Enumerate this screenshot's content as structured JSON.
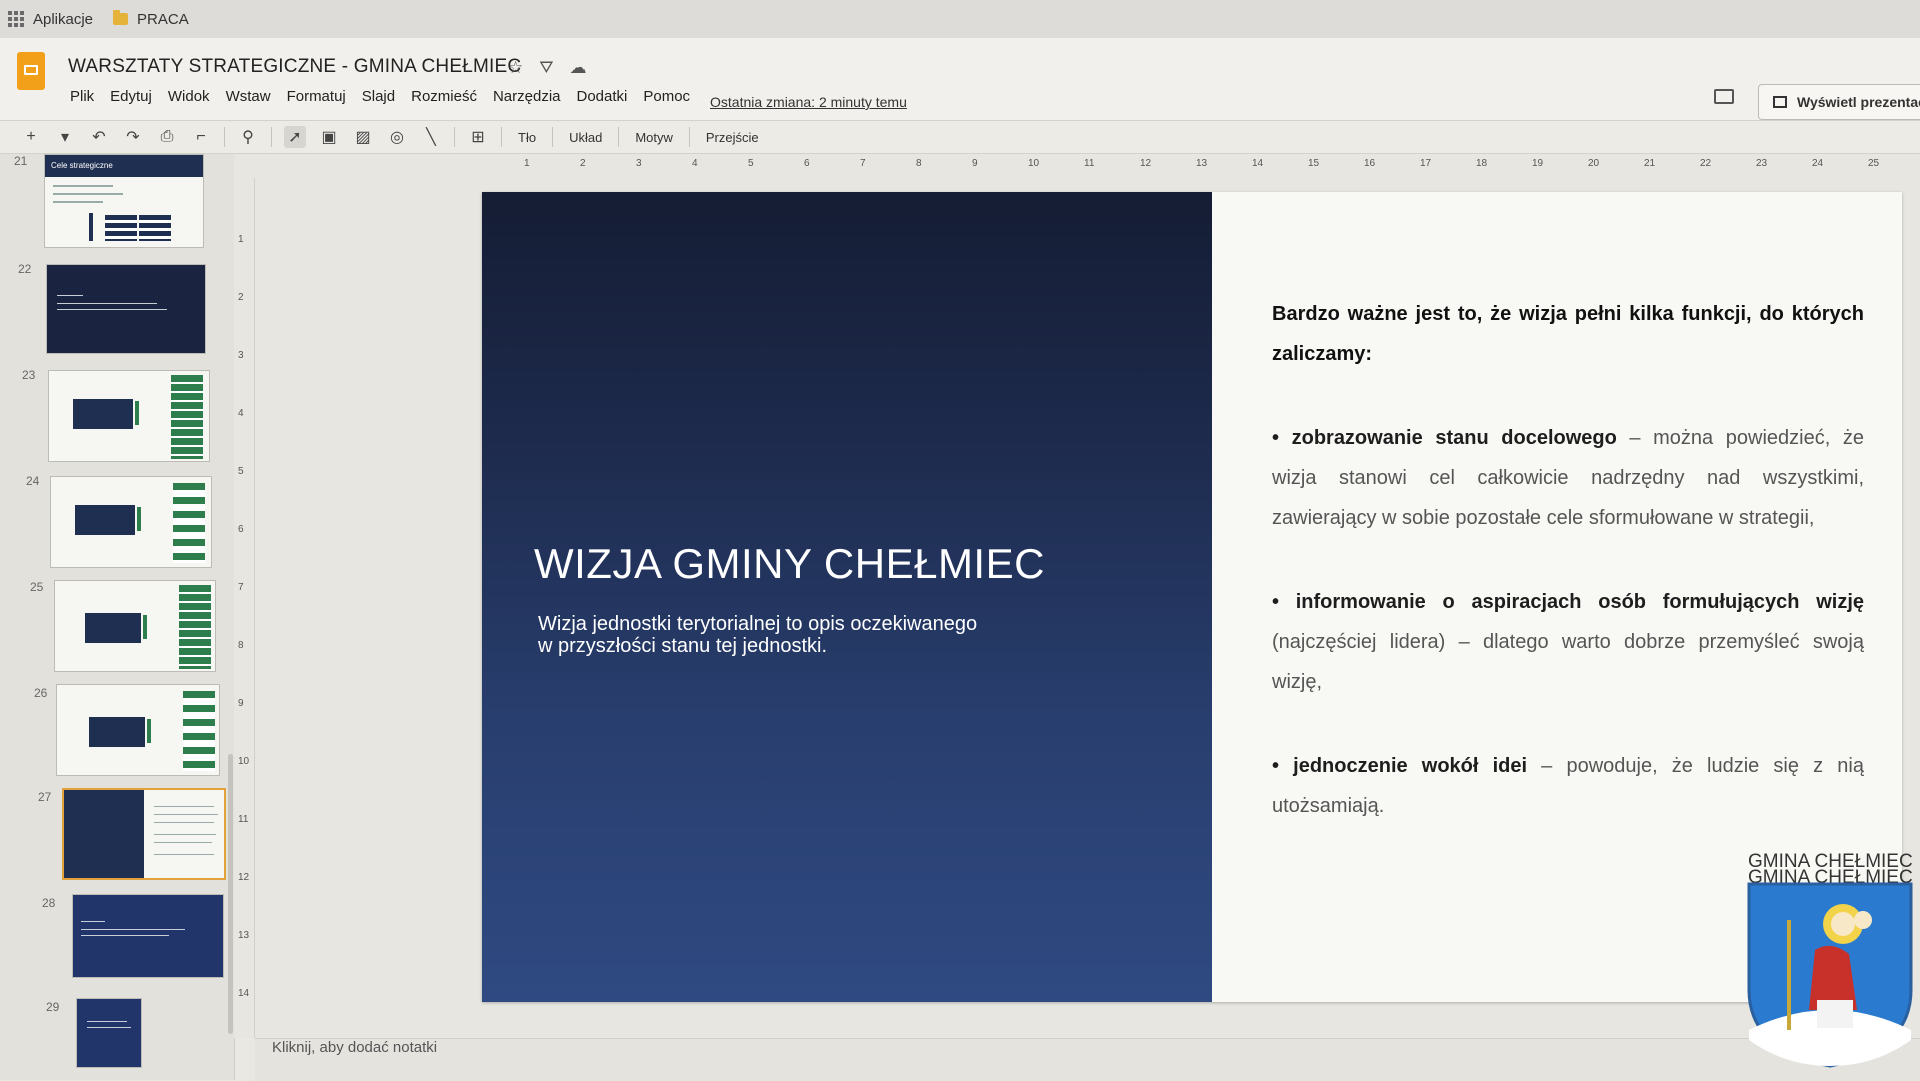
{
  "bookmarks": {
    "apps_label": "Aplikacje",
    "folder_label": "PRACA"
  },
  "header": {
    "doc_title": "WARSZTATY STRATEGICZNE - GMINA CHEŁMIEC",
    "menu": [
      "Plik",
      "Edytuj",
      "Widok",
      "Wstaw",
      "Formatuj",
      "Slajd",
      "Rozmieść",
      "Narzędzia",
      "Dodatki",
      "Pomoc"
    ],
    "last_edit": "Ostatnia zmiana: 2 minuty temu",
    "present_label": "Wyświetl prezentację"
  },
  "toolbar": {
    "background_label": "Tło",
    "layout_label": "Układ",
    "theme_label": "Motyw",
    "transition_label": "Przejście"
  },
  "filmstrip": {
    "numbers": [
      "21",
      "22",
      "23",
      "24",
      "25",
      "26",
      "27",
      "28",
      "29"
    ],
    "thumb21_title": "Cele strategiczne",
    "active_slide": "27"
  },
  "rulers": {
    "h_ticks": [
      "1",
      "2",
      "3",
      "4",
      "5",
      "6",
      "7",
      "8",
      "9",
      "10",
      "11",
      "12",
      "13",
      "14",
      "15",
      "16",
      "17",
      "18",
      "19",
      "20",
      "21",
      "22",
      "23",
      "24",
      "25"
    ],
    "v_ticks": [
      "1",
      "2",
      "3",
      "4",
      "5",
      "6",
      "7",
      "8",
      "9",
      "10",
      "11",
      "12",
      "13",
      "14"
    ]
  },
  "slide": {
    "title": "WIZJA GMINY CHEŁMIEC",
    "subtitle_line1": "Wizja jednostki terytorialnej to opis oczekiwanego",
    "subtitle_line2": "w przyszłości stanu tej jednostki.",
    "intro": "Bardzo ważne jest to, że wizja pełni kilka funkcji, do których zaliczamy:",
    "bullet1_bold": "• zobrazowanie stanu docelowego",
    "bullet1_text": " – można powiedzieć, że wizja stanowi cel całkowicie nadrzędny nad wszystkimi, zawierający w sobie pozostałe cele sformułowane w strategii,",
    "bullet2_bold": "• informowanie o aspiracjach osób formułujących wizję",
    "bullet2_text": " (najczęściej lidera) – dlatego warto dobrze przemyśleć swoją wizję,",
    "bullet3_bold": "• jednoczenie wokół idei",
    "bullet3_text": " – powoduje, że ludzie się z nią utożsamiają."
  },
  "watermark": {
    "label": "GMINA CHEŁMIEC"
  },
  "notes": {
    "placeholder": "Kliknij, aby dodać notatki"
  },
  "colors": {
    "accent_orange": "#f29f1a",
    "slide_dark": "#1d2a4c",
    "thumb_green": "#2e7d4c"
  }
}
